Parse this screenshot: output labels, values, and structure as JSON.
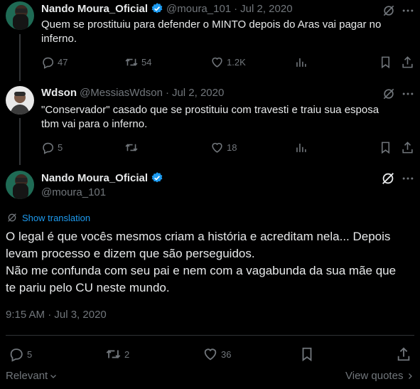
{
  "tweet1": {
    "name": "Nando Moura_Oficial",
    "handle": "@moura_101",
    "sep": "·",
    "date": "Jul 2, 2020",
    "text_line1": "Quem se prostituiu para defender o MINTO depois do Aras vai pagar no",
    "text_line2": "inferno.",
    "replies": "47",
    "retweets": "54",
    "likes": "1.2K"
  },
  "tweet2": {
    "name": "Wdson",
    "handle": "@MessiasWdson",
    "sep": "·",
    "date": "Jul 2, 2020",
    "text_line1": "\"Conservador\" casado que se prostituiu com travesti e traiu sua esposa",
    "text_line2": "tbm vai para o inferno.",
    "replies": "5",
    "retweets": "",
    "likes": "18"
  },
  "main": {
    "name": "Nando Moura_Oficial",
    "handle": "@moura_101",
    "show_translation": "Show translation",
    "text_line1": "O legal é que vocês mesmos criam a história e acreditam nela... Depois",
    "text_line2": "levam processo e dizem que são perseguidos.",
    "text_line3": "Não me confunda com seu pai e nem com a vagabunda da sua mãe que",
    "text_line4": "te pariu pelo CU neste mundo.",
    "timestamp": "9:15 AM · Jul 3, 2020",
    "replies": "5",
    "retweets": "2",
    "likes": "36"
  },
  "footer": {
    "relevant": "Relevant",
    "view_quotes": "View quotes"
  },
  "colors": {
    "background": "#000000",
    "text": "#e7e9ea",
    "muted": "#71767b",
    "link": "#1d9bf0",
    "verified": "#1d9bf0",
    "divider": "#2f3336"
  },
  "icons": [
    "reply-icon",
    "retweet-icon",
    "like-icon",
    "views-icon",
    "bookmark-icon",
    "share-icon",
    "grok-icon",
    "more-icon",
    "verified-badge-icon",
    "translate-icon",
    "chevron-down-icon",
    "chevron-right-icon"
  ]
}
